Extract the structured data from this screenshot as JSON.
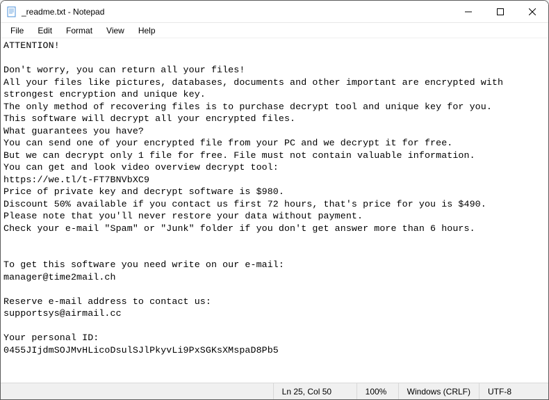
{
  "window": {
    "title": "_readme.txt - Notepad"
  },
  "menu": {
    "file": "File",
    "edit": "Edit",
    "format": "Format",
    "view": "View",
    "help": "Help"
  },
  "body": {
    "text": "ATTENTION!\n\nDon't worry, you can return all your files!\nAll your files like pictures, databases, documents and other important are encrypted with strongest encryption and unique key.\nThe only method of recovering files is to purchase decrypt tool and unique key for you.\nThis software will decrypt all your encrypted files.\nWhat guarantees you have?\nYou can send one of your encrypted file from your PC and we decrypt it for free.\nBut we can decrypt only 1 file for free. File must not contain valuable information.\nYou can get and look video overview decrypt tool:\nhttps://we.tl/t-FT7BNVbXC9\nPrice of private key and decrypt software is $980.\nDiscount 50% available if you contact us first 72 hours, that's price for you is $490.\nPlease note that you'll never restore your data without payment.\nCheck your e-mail \"Spam\" or \"Junk\" folder if you don't get answer more than 6 hours.\n\n\nTo get this software you need write on our e-mail:\nmanager@time2mail.ch\n\nReserve e-mail address to contact us:\nsupportsys@airmail.cc\n\nYour personal ID:\n0455JIjdmSOJMvHLicoDsulSJlPkyvLi9PxSGKsXMspaD8Pb5"
  },
  "statusbar": {
    "position": "Ln 25, Col 50",
    "zoom": "100%",
    "eol": "Windows (CRLF)",
    "encoding": "UTF-8"
  }
}
